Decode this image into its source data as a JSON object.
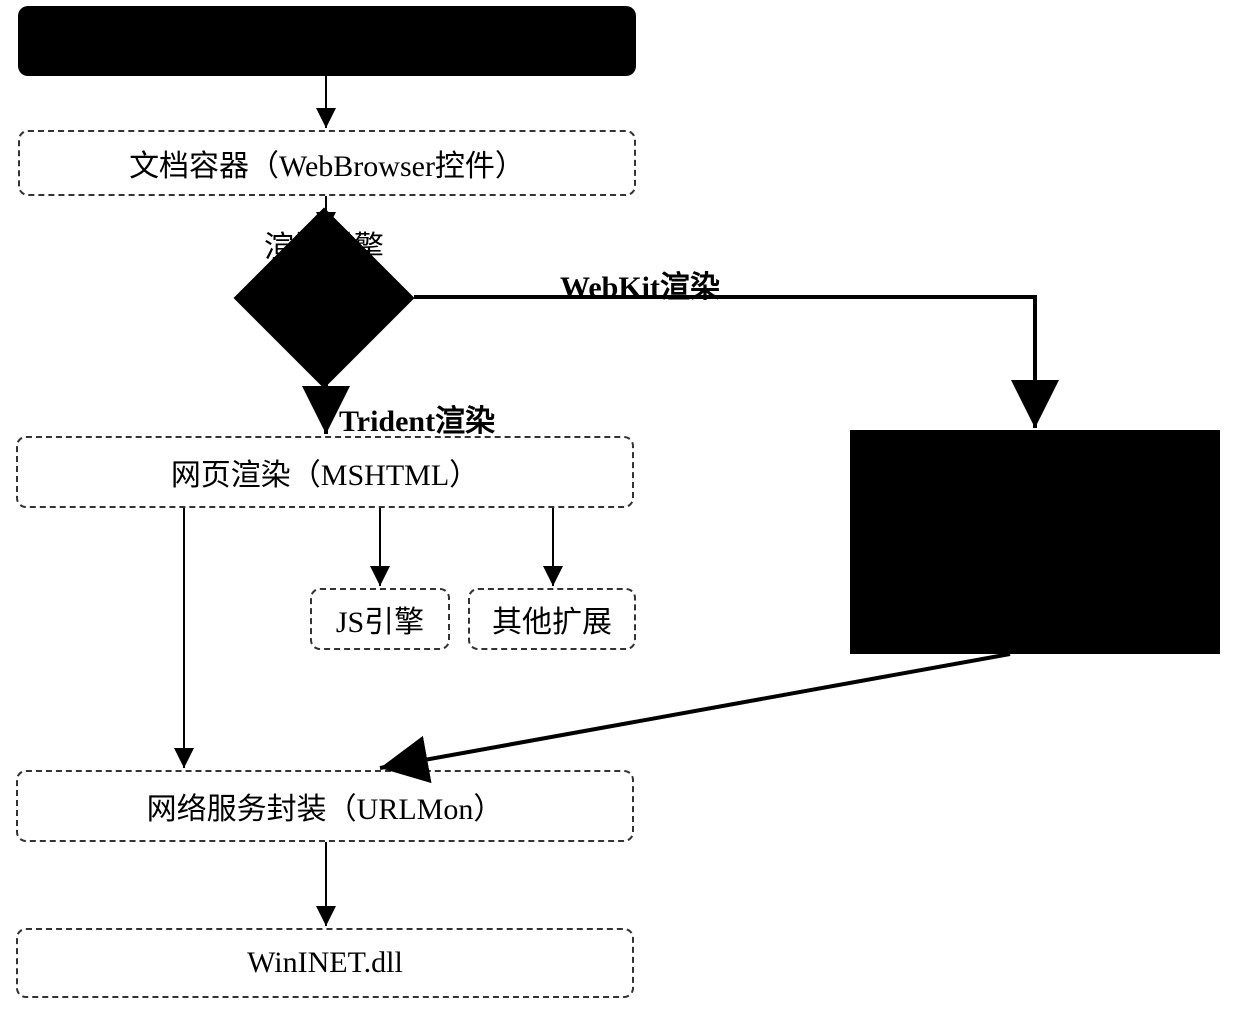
{
  "diagram": {
    "top_box": "",
    "doc_container": "文档容器（WebBrowser控件）",
    "decision_caption": "渲染引擎",
    "branch_right": "WebKit渲染",
    "branch_down": "Trident渲染",
    "web_render": "网页渲染（MSHTML）",
    "js_engine": "JS引擎",
    "other_ext": "其他扩展",
    "webkit_box": "",
    "urlmon": "网络服务封装（URLMon）",
    "wininet": "WinINET.dll"
  }
}
